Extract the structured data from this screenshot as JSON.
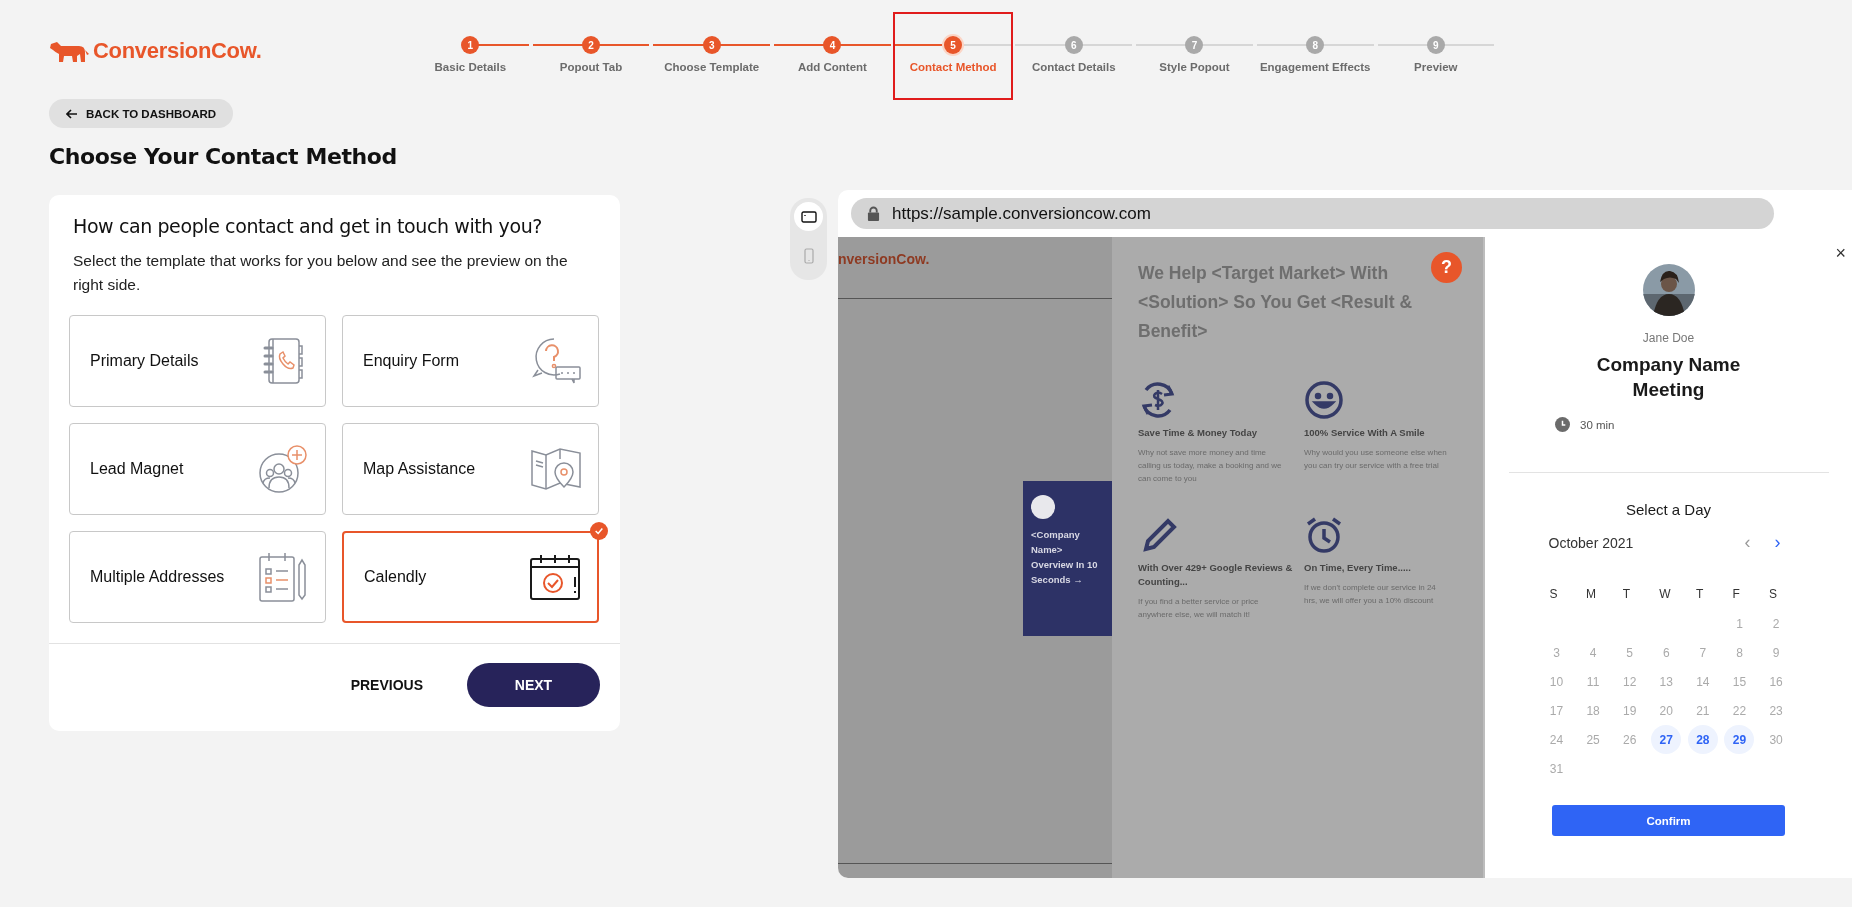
{
  "brand": {
    "name": "ConversionCow."
  },
  "steps": [
    {
      "number": "1",
      "label": "Basic Details",
      "completed": true,
      "selected": false,
      "highlighted": false
    },
    {
      "number": "2",
      "label": "Popout Tab",
      "completed": true,
      "selected": false,
      "highlighted": false
    },
    {
      "number": "3",
      "label": "Choose Template",
      "completed": true,
      "selected": false,
      "highlighted": false
    },
    {
      "number": "4",
      "label": "Add Content",
      "completed": true,
      "selected": false,
      "highlighted": false
    },
    {
      "number": "5",
      "label": "Contact Method",
      "completed": false,
      "selected": true,
      "highlighted": true
    },
    {
      "number": "6",
      "label": "Contact Details",
      "completed": false,
      "selected": false,
      "highlighted": false
    },
    {
      "number": "7",
      "label": "Style Popout",
      "completed": false,
      "selected": false,
      "highlighted": false
    },
    {
      "number": "8",
      "label": "Engagement Effects",
      "completed": false,
      "selected": false,
      "highlighted": false
    },
    {
      "number": "9",
      "label": "Preview",
      "completed": false,
      "selected": false,
      "highlighted": false
    }
  ],
  "back_button": "BACK TO DASHBOARD",
  "page_title": "Choose Your Contact Method",
  "card": {
    "question": "How can people contact and get in touch with you?",
    "description": "Select the template that works for you below and see the preview on the right side.",
    "options": [
      {
        "label": "Primary Details",
        "kind": "phonebook",
        "selected": false
      },
      {
        "label": "Enquiry Form",
        "kind": "question",
        "selected": false
      },
      {
        "label": "Lead Magnet",
        "kind": "group",
        "selected": false
      },
      {
        "label": "Map Assistance",
        "kind": "map",
        "selected": false
      },
      {
        "label": "Multiple Addresses",
        "kind": "checklist",
        "selected": false
      },
      {
        "label": "Calendly",
        "kind": "calendar",
        "selected": true
      }
    ],
    "buttons": [
      {
        "label": "PREVIOUS",
        "kind": "text"
      },
      {
        "label": "NEXT",
        "kind": "primary"
      }
    ]
  },
  "preview": {
    "devices": [
      {
        "kind": "desktop",
        "selected": true
      },
      {
        "kind": "mobile",
        "selected": false
      }
    ],
    "url": "https://sample.conversioncow.com",
    "site_logo": "nversionCow.",
    "side_tab": "<Company Name> Overview In 10 Seconds →",
    "headline": "We Help <Target Market> With <Solution> So You Get <Result & Benefit>",
    "features": [
      {
        "kind": "money",
        "title": "Save Time & Money Today",
        "text": "Why not save more money and time calling us today, make a booking and we can come to you"
      },
      {
        "kind": "smile",
        "title": "100% Service With A Smile",
        "text": "Why would you use someone else when you can try our service with a free trial"
      },
      {
        "kind": "pencil",
        "title": "With Over 429+ Google Reviews & Counting...",
        "text": "If you find a better service or price anywhere else, we will match it!"
      },
      {
        "kind": "alarm",
        "title": "On Time, Every Time.....",
        "text": "If we don't complete our service in 24 hrs, we will offer you a 10% discount"
      }
    ],
    "help": "?",
    "booking": {
      "close": "×",
      "host": "Jane Doe",
      "title": "Company Name Meeting",
      "duration": "30 min",
      "section": "Select a Day",
      "month": "October 2021",
      "prev": "‹",
      "next": "›",
      "weekdays": [
        "S",
        "M",
        "T",
        "W",
        "T",
        "F",
        "S"
      ],
      "days": [
        {
          "label": "1",
          "available": false
        },
        {
          "label": "2",
          "available": false
        },
        {
          "label": "3",
          "available": false
        },
        {
          "label": "4",
          "available": false
        },
        {
          "label": "5",
          "available": false
        },
        {
          "label": "6",
          "available": false
        },
        {
          "label": "7",
          "available": false
        },
        {
          "label": "8",
          "available": false
        },
        {
          "label": "9",
          "available": false
        },
        {
          "label": "10",
          "available": false
        },
        {
          "label": "11",
          "available": false
        },
        {
          "label": "12",
          "available": false
        },
        {
          "label": "13",
          "available": false
        },
        {
          "label": "14",
          "available": false
        },
        {
          "label": "15",
          "available": false
        },
        {
          "label": "16",
          "available": false
        },
        {
          "label": "17",
          "available": false
        },
        {
          "label": "18",
          "available": false
        },
        {
          "label": "19",
          "available": false
        },
        {
          "label": "20",
          "available": false
        },
        {
          "label": "21",
          "available": false
        },
        {
          "label": "22",
          "available": false
        },
        {
          "label": "23",
          "available": false
        },
        {
          "label": "24",
          "available": false
        },
        {
          "label": "25",
          "available": false
        },
        {
          "label": "26",
          "available": false
        },
        {
          "label": "27",
          "available": true
        },
        {
          "label": "28",
          "available": true
        },
        {
          "label": "29",
          "available": true
        },
        {
          "label": "30",
          "available": false
        },
        {
          "label": "31",
          "available": false
        }
      ],
      "confirm": "Confirm"
    }
  }
}
